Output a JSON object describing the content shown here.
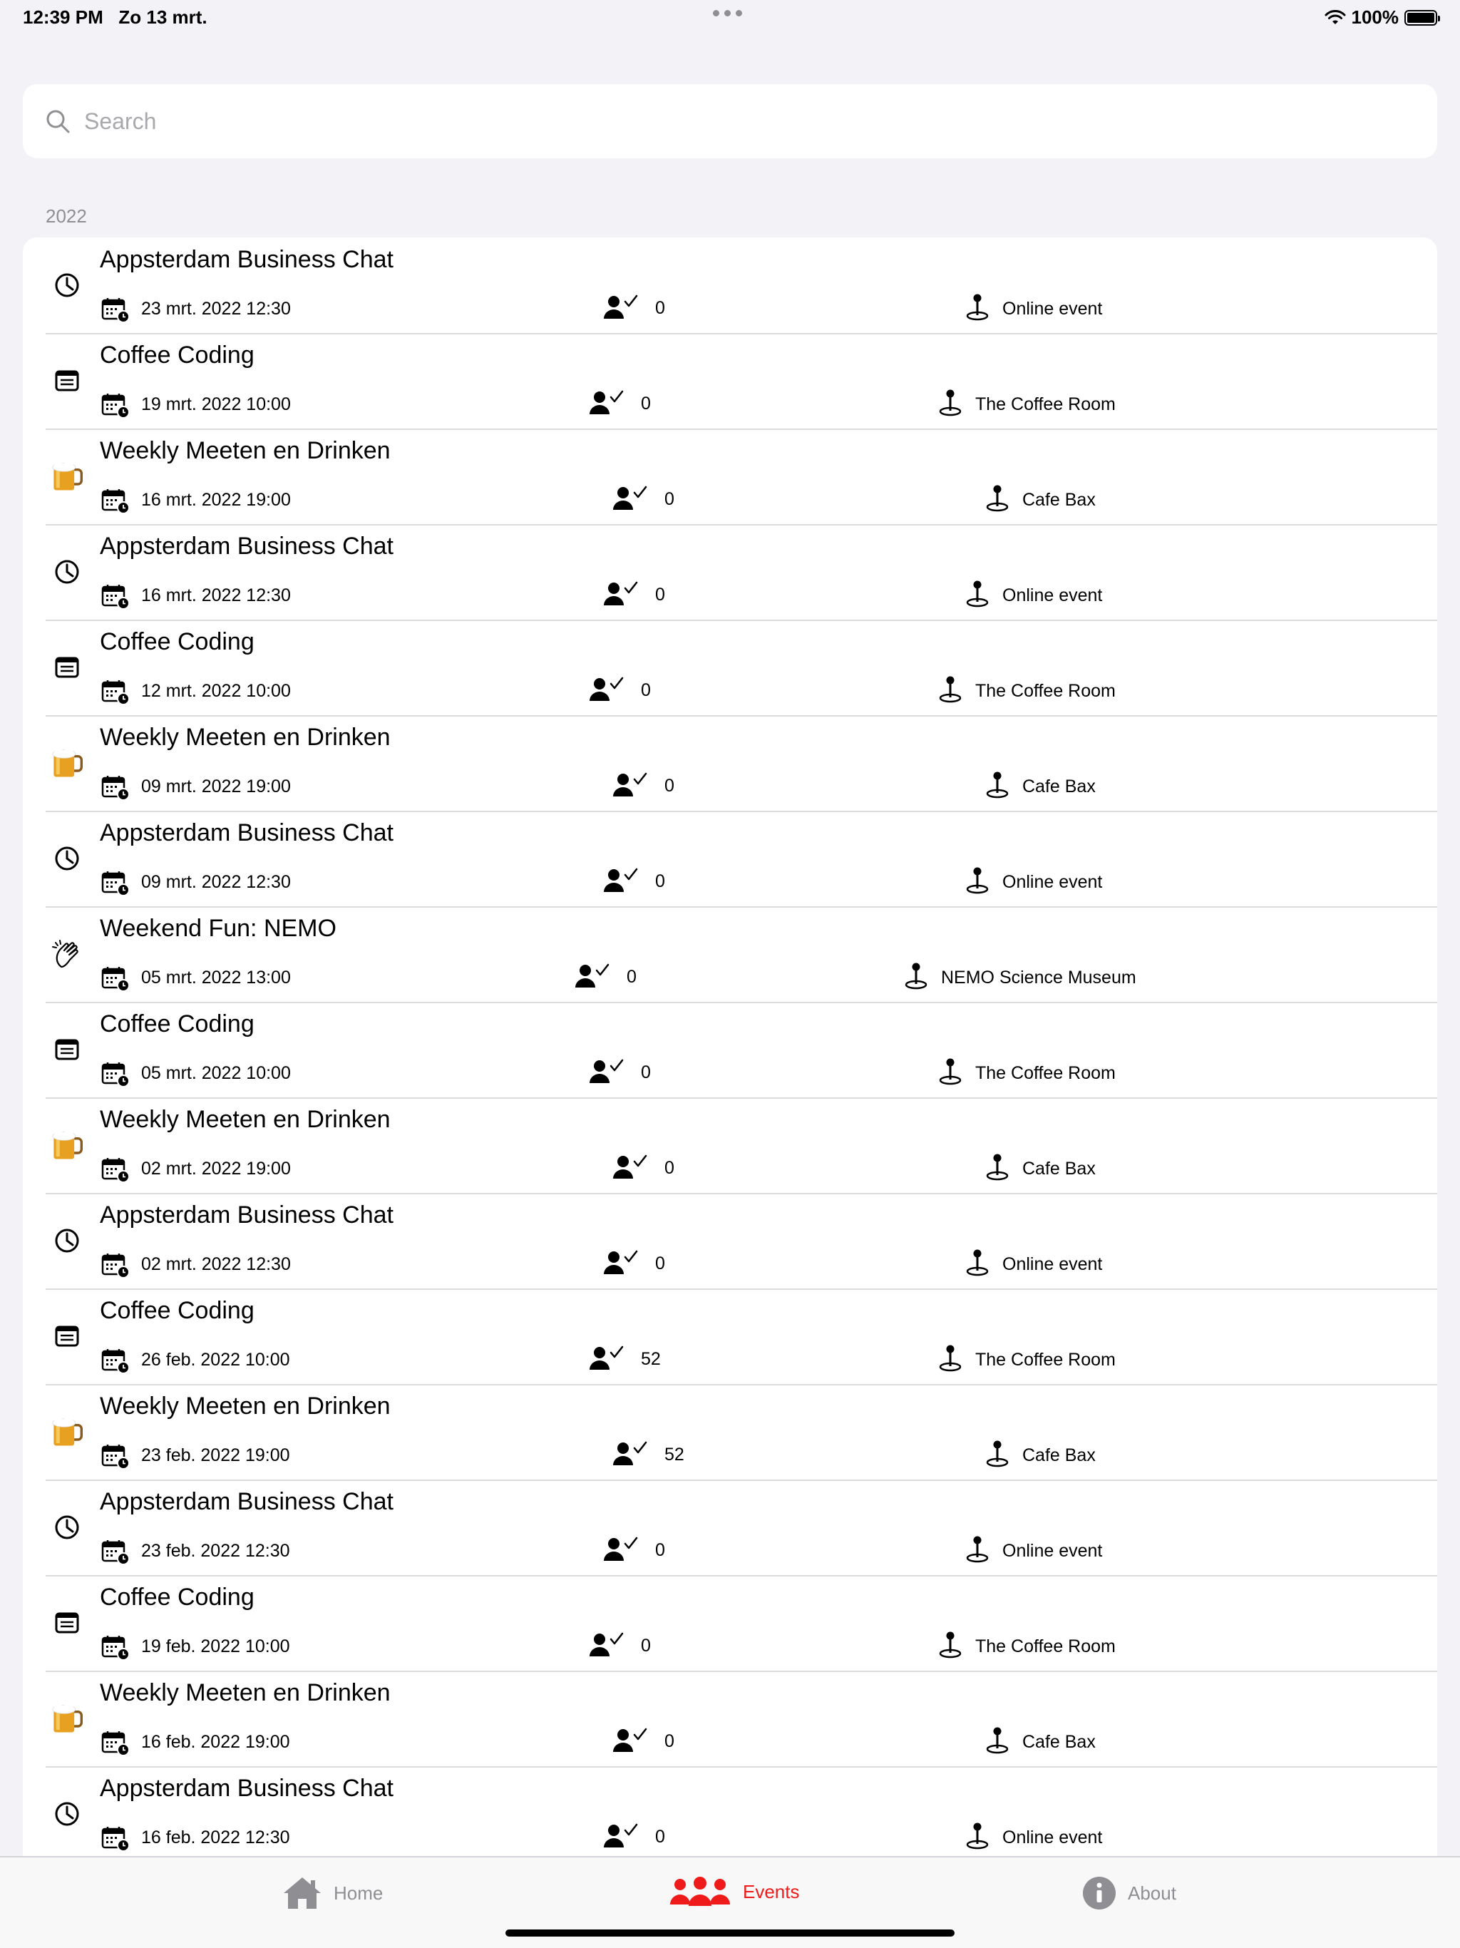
{
  "status": {
    "time": "12:39 PM",
    "date": "Zo 13 mrt.",
    "battery": "100%"
  },
  "search": {
    "placeholder": "Search"
  },
  "section": {
    "year": "2022"
  },
  "events": [
    {
      "title": "Appsterdam Business Chat",
      "icon": "clock-icon",
      "date": "23 mrt. 2022 12:30",
      "attendees": "0",
      "location": "Online event"
    },
    {
      "title": "Coffee Coding",
      "icon": "document-icon",
      "date": "19 mrt. 2022 10:00",
      "attendees": "0",
      "location": "The Coffee Room"
    },
    {
      "title": "Weekly Meeten en Drinken",
      "icon": "beer-mug-icon",
      "date": "16 mrt. 2022 19:00",
      "attendees": "0",
      "location": "Cafe Bax"
    },
    {
      "title": "Appsterdam Business Chat",
      "icon": "clock-icon",
      "date": "16 mrt. 2022 12:30",
      "attendees": "0",
      "location": "Online event"
    },
    {
      "title": "Coffee Coding",
      "icon": "document-icon",
      "date": "12 mrt. 2022 10:00",
      "attendees": "0",
      "location": "The Coffee Room"
    },
    {
      "title": "Weekly Meeten en Drinken",
      "icon": "beer-mug-icon",
      "date": "09 mrt. 2022 19:00",
      "attendees": "0",
      "location": "Cafe Bax"
    },
    {
      "title": "Appsterdam Business Chat",
      "icon": "clock-icon",
      "date": "09 mrt. 2022 12:30",
      "attendees": "0",
      "location": "Online event"
    },
    {
      "title": "Weekend Fun: NEMO",
      "icon": "clapping-hands-icon",
      "date": "05 mrt. 2022 13:00",
      "attendees": "0",
      "location": "NEMO Science Museum"
    },
    {
      "title": "Coffee Coding",
      "icon": "document-icon",
      "date": "05 mrt. 2022 10:00",
      "attendees": "0",
      "location": "The Coffee Room"
    },
    {
      "title": "Weekly Meeten en Drinken",
      "icon": "beer-mug-icon",
      "date": "02 mrt. 2022 19:00",
      "attendees": "0",
      "location": "Cafe Bax"
    },
    {
      "title": "Appsterdam Business Chat",
      "icon": "clock-icon",
      "date": "02 mrt. 2022 12:30",
      "attendees": "0",
      "location": "Online event"
    },
    {
      "title": "Coffee Coding",
      "icon": "document-icon",
      "date": "26 feb. 2022 10:00",
      "attendees": "52",
      "location": "The Coffee Room"
    },
    {
      "title": "Weekly Meeten en Drinken",
      "icon": "beer-mug-icon",
      "date": "23 feb. 2022 19:00",
      "attendees": "52",
      "location": "Cafe Bax"
    },
    {
      "title": "Appsterdam Business Chat",
      "icon": "clock-icon",
      "date": "23 feb. 2022 12:30",
      "attendees": "0",
      "location": "Online event"
    },
    {
      "title": "Coffee Coding",
      "icon": "document-icon",
      "date": "19 feb. 2022 10:00",
      "attendees": "0",
      "location": "The Coffee Room"
    },
    {
      "title": "Weekly Meeten en Drinken",
      "icon": "beer-mug-icon",
      "date": "16 feb. 2022 19:00",
      "attendees": "0",
      "location": "Cafe Bax"
    },
    {
      "title": "Appsterdam Business Chat",
      "icon": "clock-icon",
      "date": "16 feb. 2022 12:30",
      "attendees": "0",
      "location": "Online event"
    }
  ],
  "tabs": [
    {
      "label": "Home",
      "icon": "house-icon",
      "active": false
    },
    {
      "label": "Events",
      "icon": "people-icon",
      "active": true
    },
    {
      "label": "About",
      "icon": "info-icon",
      "active": false
    }
  ],
  "colors": {
    "accent": "#ef1a1a",
    "inactive": "#8e8e93"
  }
}
